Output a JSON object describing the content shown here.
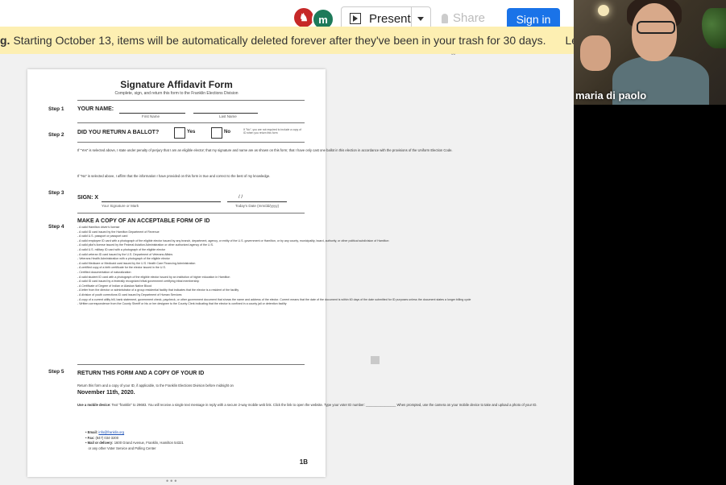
{
  "topbar": {
    "avatar_red": "♞",
    "avatar_green": "m",
    "present": "Present",
    "share": "Share",
    "signin": "Sign in"
  },
  "banner": {
    "prefix": "g.",
    "text": "Starting October 13, items will be automatically deleted forever after they've been in your trash for 30 days.",
    "learn": "Learn"
  },
  "participant": {
    "name": "maria di paolo"
  },
  "doc": {
    "title": "Signature Affidavit Form",
    "subtitle": "Complete, sign, and return this form to the Franklin Elections Division",
    "step1": "Step 1",
    "your_name": "YOUR NAME:",
    "first_name": "First Name",
    "last_name": "Last Name",
    "step2": "Step 2",
    "did_you_return": "DID YOU RETURN A BALLOT?",
    "yes": "Yes",
    "no": "No",
    "no_note": "If \"No\", you are not required to include a copy of ID when you return this form",
    "yes_para": "If \"Yes\" is selected above, I state under penalty of perjury that I am an eligible elector; that my signature and name are as shown on this form; that I have only cast one ballot in this election in accordance with the provisions of the Uniform Election Code.",
    "no_para": "If \"No\" is selected above, I affirm that the information I have provided on this form is true and correct to the best of my knowledge.",
    "step3": "Step 3",
    "sign": "SIGN: X",
    "date_sep": "/          /",
    "sig_label": "Your Signature or Mark",
    "date_label": "Today's Date (mm/dd/yyyy)",
    "step4": "Step 4",
    "id_heading": "MAKE A COPY OF AN ACCEPTABLE FORM OF ID",
    "id_list": [
      "- A valid Hamilton driver's license",
      "- A valid ID card issued by the Hamilton Department of Revenue",
      "- A valid U.S. passport or passport card",
      "- A valid employee ID card with a photograph of the eligible elector issued by any branch, department, agency, or entity of the U.S. government or Hamilton, or by any county, municipality, board, authority, or other political subdivision of Hamilton",
      "- A valid pilot's license issued by the Federal Aviation Administration or other authorized agency of the U.S.",
      "- A valid U.S. military ID card with a photograph of the eligible elector",
      "- A valid veteran ID card issued by the U.S. Department of Veterans Affairs",
      "- Veterans Health Administration with a photograph of the eligible elector",
      "- A valid Medicare or Medicaid card issued by the U.S. Health Care Financing Administration",
      "- A certified copy of a birth certificate for the elector issued in the U.S.",
      "- Certified documentation of naturalization",
      "- A valid student ID card with a photograph of the eligible elector issued by an institution of higher education in Hamilton",
      "- A valid ID card issued by a federally recognized tribal government certifying tribal membership",
      "- A Certificate of Degree of Indian or Alaskan Native Blood",
      "- A letter from the director or administrator of a group residential facility that indicates that the elector is a resident of the facility",
      "- A division of youth corrections ID card issued by Department of Human Services",
      "- A copy of a current utility bill, bank statement, government check, paycheck, or other government document that shows the name and address of the elector. Current means that the date of the document is within 60 days of the date submitted for ID purposes unless the document states a longer billing cycle",
      "- Written correspondence from the County Sheriff or his or her designee to the County Clerk indicating that the elector is confined in a county jail or detention facility"
    ],
    "step5": "Step 5",
    "return_heading": "RETURN THIS FORM AND A COPY OF YOUR ID",
    "return_para": "Return this form and a copy of your ID, if applicable, to the Franklin Elections Division before midnight on",
    "deadline": "November 11th, 2020.",
    "mobile_bold": "Use a mobile device:",
    "mobile_text": "Text \"franklin\" to 29683. You will receive a single text message in reply with a secure 2-way mobile web link. Click the link to open the website. Type your voter ID number: ________________ When prompted, use the camera on your mobile device to take and upload a photo of your ID.",
    "email_label": "Email:",
    "email_value": "info@franklin.org",
    "fax_label": "Fax:",
    "fax_value": "(847) 034-3200",
    "mail_label": "Mail or delivery:",
    "mail_value": "1600 Grand Avenue, Franklin, Hamilton 54321",
    "mail_value2": "or any other Voter Service and Polling Center",
    "page_no": "1B"
  },
  "scroll_hint": "ˇˇ",
  "dots": "•••"
}
